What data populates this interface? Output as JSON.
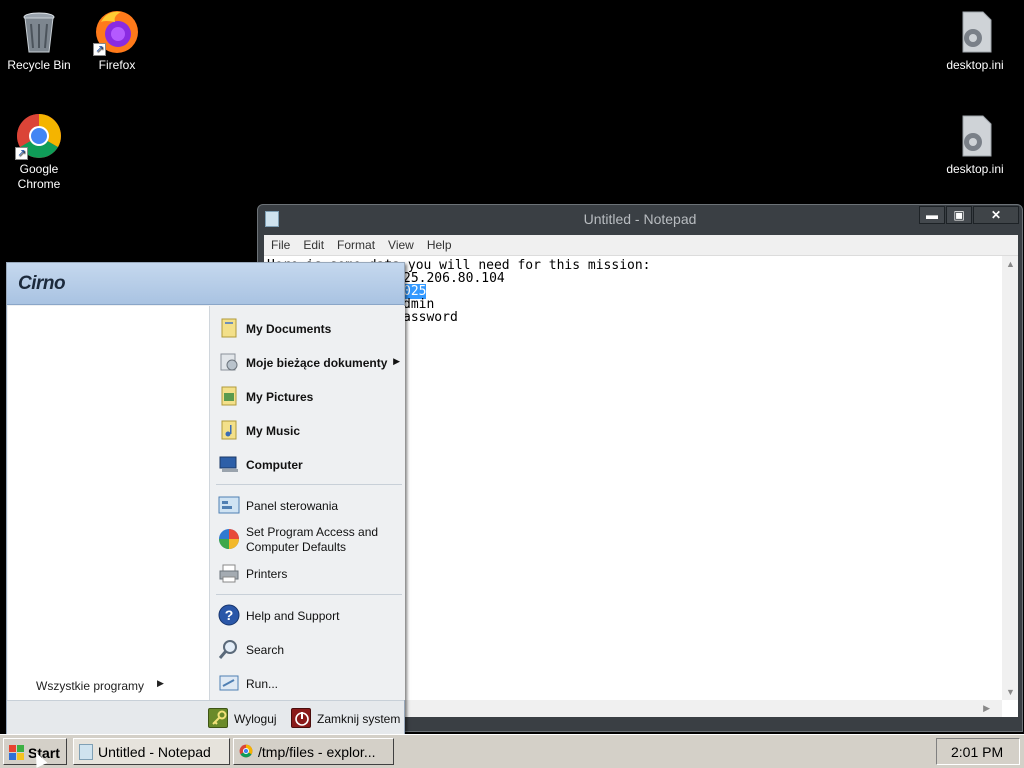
{
  "desktop": {
    "icons": [
      {
        "label": "Recycle Bin",
        "icon": "recycle-bin-icon"
      },
      {
        "label": "Firefox",
        "icon": "firefox-icon"
      },
      {
        "label": "Google Chrome",
        "icon": "chrome-icon"
      },
      {
        "label": "desktop.ini",
        "icon": "settings-file-icon"
      },
      {
        "label": "desktop.ini",
        "icon": "settings-file-icon"
      }
    ]
  },
  "notepad": {
    "title": "Untitled - Notepad",
    "controls": {
      "minimize": "▬",
      "maximize": "▣",
      "close": "✕"
    },
    "menu": [
      "File",
      "Edit",
      "Format",
      "View",
      "Help"
    ],
    "lines": [
      "Here is some data you will need for this mission:",
      "25.206.80.104",
      "025",
      "dmin",
      "assword"
    ]
  },
  "start_menu": {
    "user": "Cirno",
    "all_programs": "Wszystkie programy",
    "right_items": [
      {
        "label": "My Documents",
        "icon": "documents-folder-icon"
      },
      {
        "label": "Moje bieżące dokumenty",
        "icon": "recent-documents-icon"
      },
      {
        "label": "My Pictures",
        "icon": "pictures-folder-icon"
      },
      {
        "label": "My Music",
        "icon": "music-folder-icon"
      },
      {
        "label": "Computer",
        "icon": "computer-icon"
      },
      {
        "label": "Panel sterowania",
        "icon": "control-panel-icon"
      },
      {
        "label": "Set Program Access and Computer Defaults",
        "icon": "program-defaults-icon"
      },
      {
        "label": "Printers",
        "icon": "printer-icon"
      },
      {
        "label": "Help and Support",
        "icon": "help-icon"
      },
      {
        "label": "Search",
        "icon": "search-icon"
      },
      {
        "label": "Run...",
        "icon": "run-icon"
      }
    ],
    "logoff": "Wyloguj",
    "shutdown": "Zamknij system"
  },
  "taskbar": {
    "start": "Start",
    "tasks": [
      {
        "label": "Untitled - Notepad",
        "icon": "notepad-icon"
      },
      {
        "label": "/tmp/files - explor...",
        "icon": "chrome-icon"
      }
    ],
    "clock": "2:01 PM"
  },
  "colors": {
    "selection": "#3399ff",
    "start_header": "#a9c3e2",
    "taskbar": "#d4d0c8"
  }
}
